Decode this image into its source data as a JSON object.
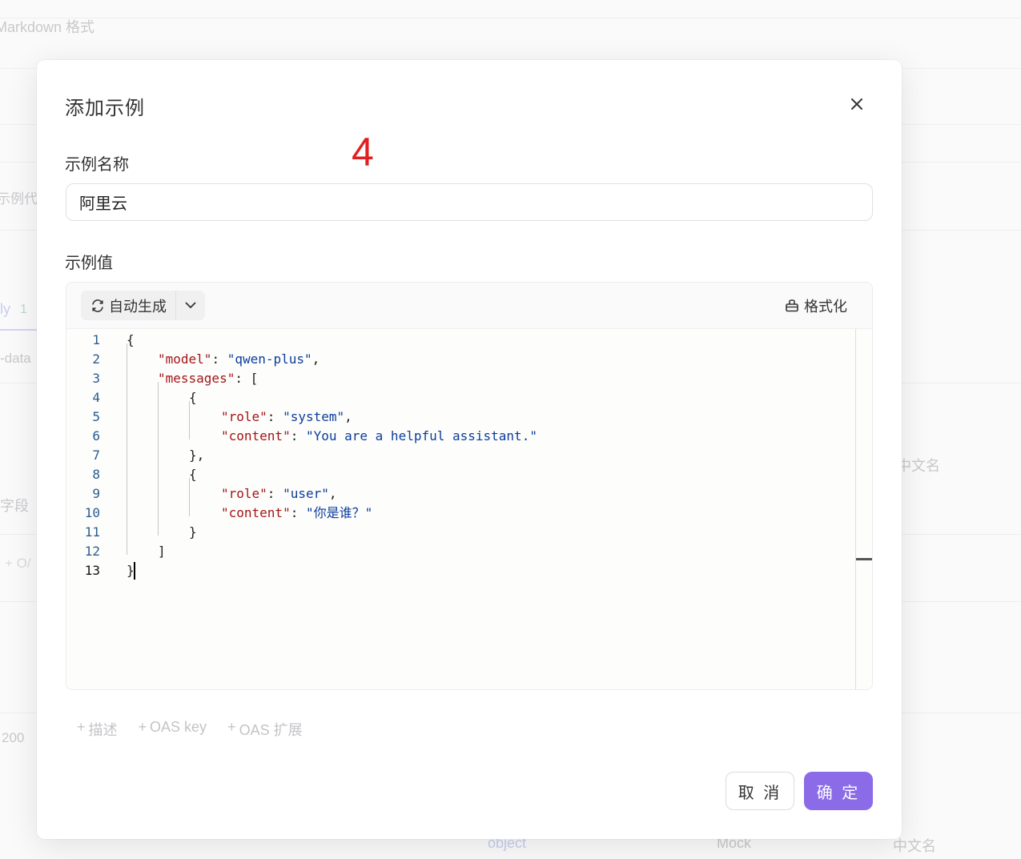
{
  "background": {
    "markdown_label": "Markdown 格式",
    "example_code_label": "示例代",
    "body_tab": "ly",
    "body_count": "1",
    "form_data": "-data",
    "field_label": "字段",
    "oas_add": "+ O/",
    "status_code": "200",
    "cn_name_1": "中文名",
    "cn_name_2": "中文名",
    "object_type": "object",
    "mock_label": "Mock"
  },
  "modal": {
    "title": "添加示例",
    "annotation": "4",
    "name_label": "示例名称",
    "name_value": "阿里云",
    "value_label": "示例值",
    "auto_generate": "自动生成",
    "format": "格式化",
    "add_description": "描述",
    "add_oas_key": "OAS key",
    "add_oas_extension": "OAS 扩展",
    "cancel": "取 消",
    "confirm": "确 定"
  },
  "code": {
    "model_key": "\"model\"",
    "model_value": "\"qwen-plus\"",
    "messages_key": "\"messages\"",
    "role_key": "\"role\"",
    "content_key": "\"content\"",
    "system_value": "\"system\"",
    "system_content": "\"You are a helpful assistant.\"",
    "user_value": "\"user\"",
    "user_content": "\"你是谁？\""
  },
  "colors": {
    "primary": "#8b6be8",
    "annotation": "#e02020",
    "json_key": "#a31515",
    "json_string": "#0b3d9c"
  }
}
